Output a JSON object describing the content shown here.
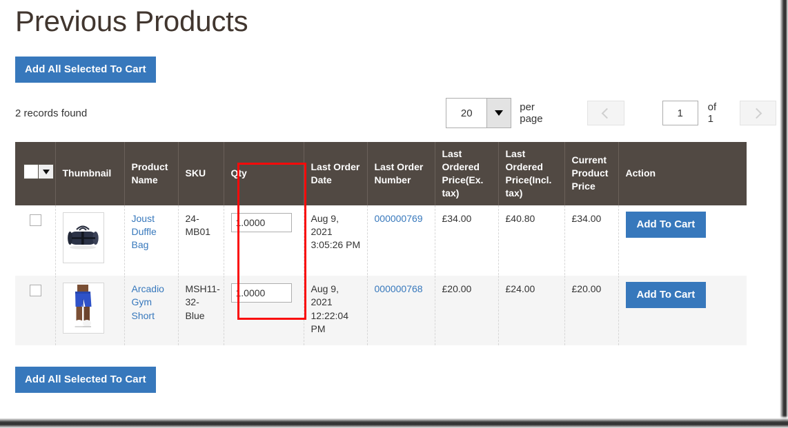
{
  "page": {
    "title": "Previous Products"
  },
  "toolbar": {
    "add_all_top_label": "Add All Selected To Cart",
    "add_all_bottom_label": "Add All Selected To Cart",
    "records_found": "2 records found"
  },
  "pager": {
    "limit_value": "20",
    "per_page_label": "per page",
    "page_value": "1",
    "of_label": "of 1",
    "prev_icon": "chevron-left-icon",
    "next_icon": "chevron-right-icon",
    "limiter_icon": "caret-down-icon"
  },
  "grid": {
    "select_all_icon": "caret-down-icon",
    "columns": [
      {
        "key": "check",
        "label": ""
      },
      {
        "key": "thumbnail",
        "label": "Thumbnail"
      },
      {
        "key": "product_name",
        "label": "Product Name"
      },
      {
        "key": "sku",
        "label": "SKU"
      },
      {
        "key": "qty",
        "label": "Qty"
      },
      {
        "key": "last_order_date",
        "label": "Last Order Date"
      },
      {
        "key": "last_order_number",
        "label": "Last Order Number"
      },
      {
        "key": "price_ex_tax",
        "label": "Last Ordered Price(Ex. tax)"
      },
      {
        "key": "price_incl_tax",
        "label": "Last Ordered Price(Incl. tax)"
      },
      {
        "key": "current_price",
        "label": "Current Product Price"
      },
      {
        "key": "action",
        "label": "Action"
      }
    ],
    "rows": [
      {
        "checked": false,
        "thumbnail_icon": "duffle-bag-thumbnail",
        "product_name": "Joust Duffle Bag",
        "sku": "24-MB01",
        "qty": "1.0000",
        "last_order_date": "Aug 9, 2021 3:05:26 PM",
        "last_order_number": "000000769",
        "price_ex_tax": "£34.00",
        "price_incl_tax": "£40.80",
        "current_price": "£34.00",
        "action_label": "Add To Cart"
      },
      {
        "checked": false,
        "thumbnail_icon": "gym-short-thumbnail",
        "product_name": "Arcadio Gym Short",
        "sku": "MSH11-32-Blue",
        "qty": "1.0000",
        "last_order_date": "Aug 9, 2021 12:22:04 PM",
        "last_order_number": "000000768",
        "price_ex_tax": "£20.00",
        "price_incl_tax": "£24.00",
        "current_price": "£20.00",
        "action_label": "Add To Cart"
      }
    ]
  },
  "annotation": {
    "qty_highlight_color": "#fa0a0a"
  },
  "colors": {
    "header_bg": "#514943",
    "primary_button": "#3778bc",
    "link": "#3778bc",
    "title": "#41362f",
    "row_alt_bg": "#f5f5f5"
  }
}
